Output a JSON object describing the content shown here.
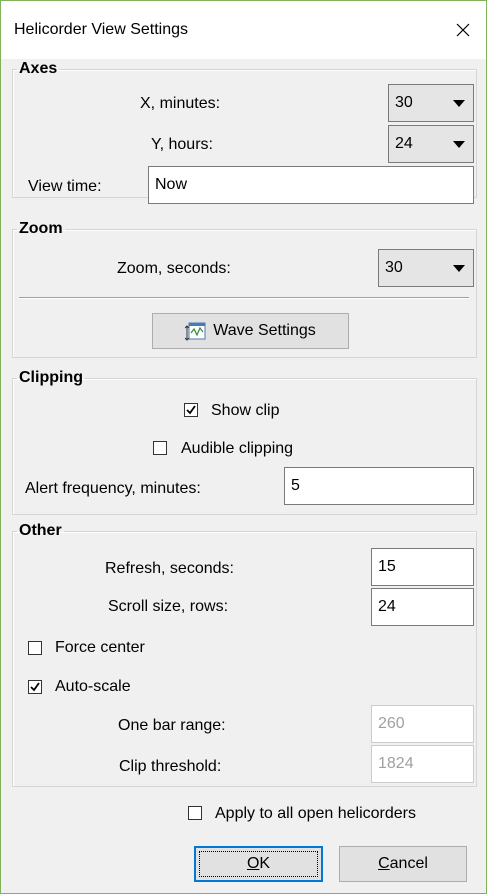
{
  "window": {
    "title": "Helicorder View Settings"
  },
  "axes": {
    "legend": "Axes",
    "x_label": "X, minutes:",
    "x_value": "30",
    "y_label": "Y, hours:",
    "y_value": "24",
    "view_time_label": "View time:",
    "view_time_value": "Now"
  },
  "zoom": {
    "legend": "Zoom",
    "zoom_label": "Zoom, seconds:",
    "zoom_value": "30",
    "wave_settings_label": "Wave Settings"
  },
  "clipping": {
    "legend": "Clipping",
    "show_clip_label": "Show clip",
    "show_clip_checked": true,
    "audible_clipping_label": "Audible clipping",
    "audible_clipping_checked": false,
    "alert_label": "Alert frequency, minutes:",
    "alert_value": "5"
  },
  "other": {
    "legend": "Other",
    "refresh_label": "Refresh, seconds:",
    "refresh_value": "15",
    "scroll_label": "Scroll size, rows:",
    "scroll_value": "24",
    "force_center_label": "Force center",
    "force_center_checked": false,
    "auto_scale_label": "Auto-scale",
    "auto_scale_checked": true,
    "bar_range_label": "One bar range:",
    "bar_range_value": "260",
    "clip_threshold_label": "Clip threshold:",
    "clip_threshold_value": "1824"
  },
  "footer": {
    "apply_all_label": "Apply to all open helicorders",
    "apply_all_checked": false,
    "ok_mnemonic": "O",
    "ok_rest": "K",
    "cancel_mnemonic": "C",
    "cancel_rest": "ancel"
  },
  "colors": {
    "window_border": "#7fb35a",
    "default_button_border": "#0078d7",
    "disabled_text": "#a0a0a0"
  }
}
